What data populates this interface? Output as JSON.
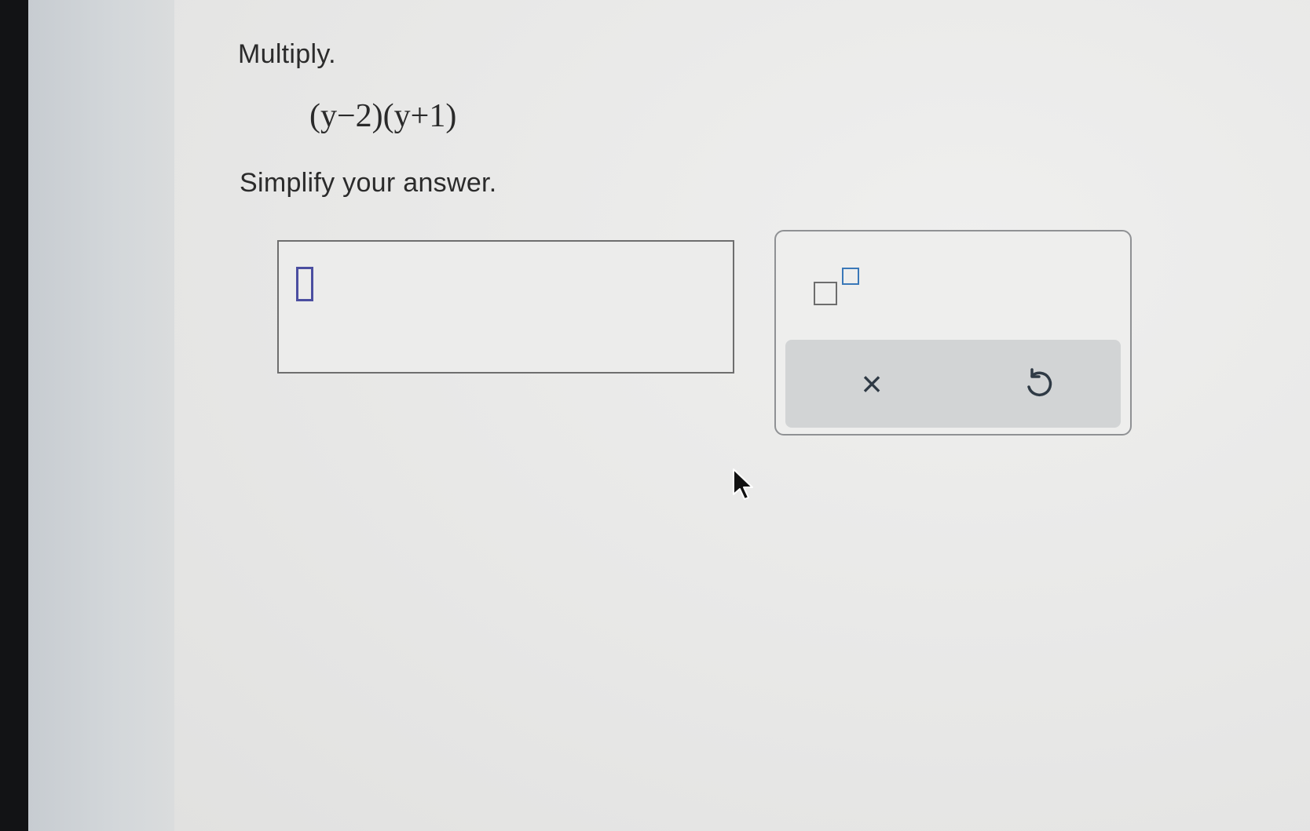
{
  "problem": {
    "title": "Multiply.",
    "expression": "(y−2)(y+1)",
    "instruction": "Simplify your answer."
  },
  "answer": {
    "value": ""
  },
  "toolbar": {
    "exponent_icon": "exponent-template-icon",
    "clear_label": "×",
    "clear_icon": "close-icon",
    "undo_icon": "undo-icon"
  },
  "colors": {
    "cursor_box": "#4b4ea0",
    "exponent_power": "#3a78b8",
    "action_bar": "#d2d4d5"
  }
}
